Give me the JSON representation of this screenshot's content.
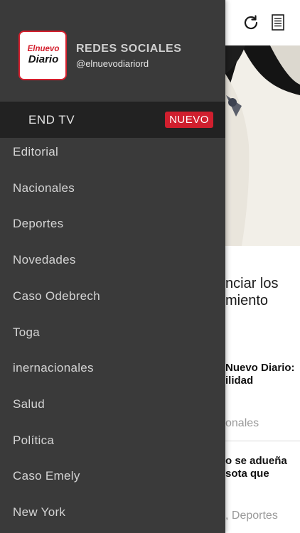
{
  "drawer": {
    "social_title": "REDES SOCIALES",
    "social_handle": "@elnuevodiariord",
    "logo_text_top": "Elnuevo",
    "logo_text_bottom": "Diario",
    "featured": {
      "label": "END TV",
      "badge": "NUEVO"
    },
    "menu_items": [
      "Editorial",
      "Nacionales",
      "Deportes",
      "Novedades",
      "Caso Odebrech",
      "Toga",
      "inernacionales",
      "Salud",
      "Política",
      "Caso Emely",
      "New York"
    ]
  },
  "background": {
    "toolbar_icons": [
      "refresh-icon",
      "reader-list-icon"
    ],
    "headline_line1": "nciar los",
    "headline_line2": "miento",
    "story1_line1": "Nuevo Diario:",
    "story1_line2": "ilidad",
    "story1_category": "onales",
    "story2_line1": "o se adueña",
    "story2_line2": "sota que",
    "story2_category": ", Deportes"
  },
  "colors": {
    "drawer_bg": "#3a3a3a",
    "featured_row_bg": "#222222",
    "badge_red": "#d01f2e",
    "logo_red": "#d41f2d"
  }
}
